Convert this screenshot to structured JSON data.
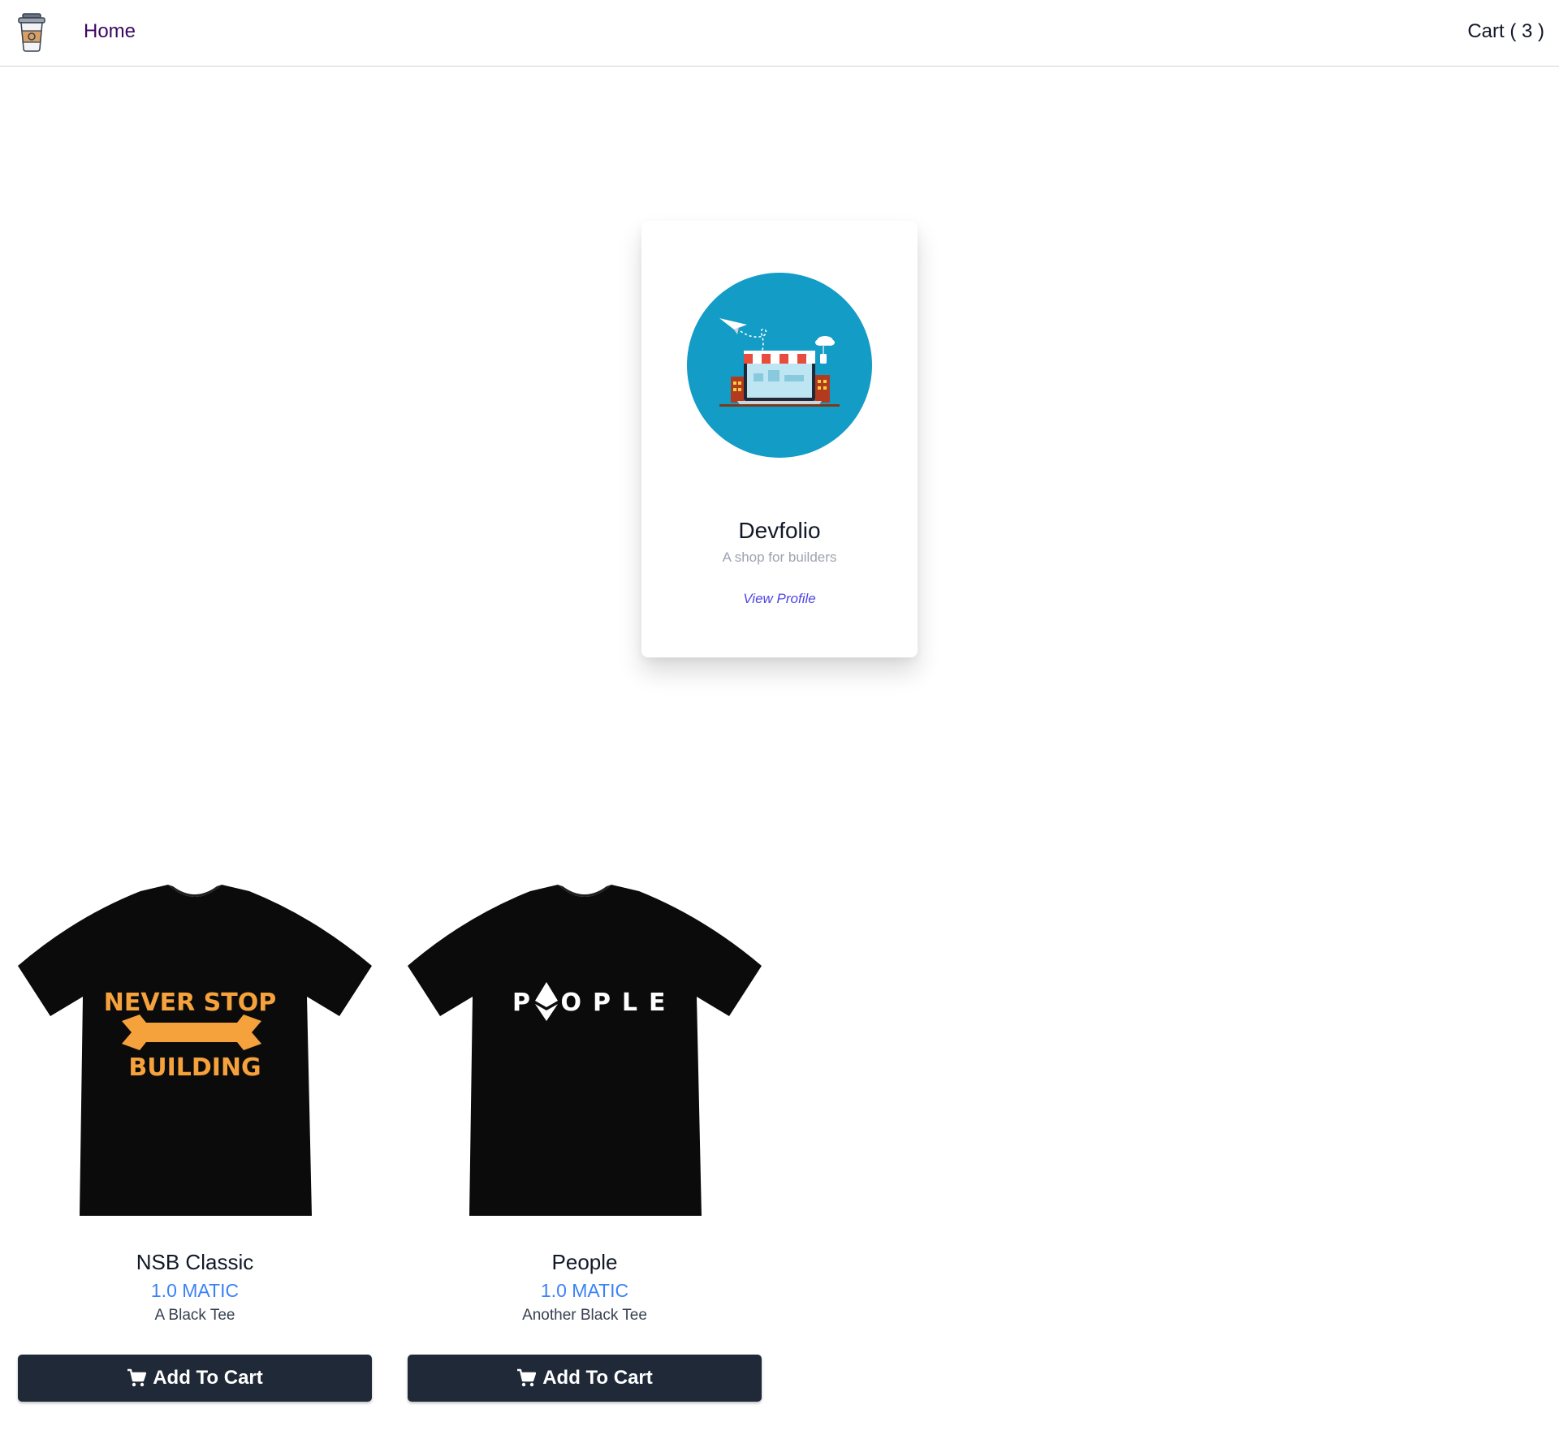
{
  "navbar": {
    "logo_icon": "coffee-cup-icon",
    "home_label": "Home",
    "cart_label": "Cart ( 3 )"
  },
  "profile": {
    "avatar_icon": "storefront-laptop-icon",
    "name": "Devfolio",
    "tagline": "A shop for builders",
    "view_profile_label": "View Profile"
  },
  "products": [
    {
      "name": "NSB Classic",
      "price": "1.0 MATIC",
      "description": "A Black Tee",
      "print_text_top": "NEVER STOP",
      "print_text_bottom": "BUILDING",
      "print_color": "#f6a23c",
      "button_label": "Add To Cart"
    },
    {
      "name": "People",
      "price": "1.0 MATIC",
      "description": "Another Black Tee",
      "print_text_left": "P",
      "print_text_right": "OPLE",
      "print_color": "#ffffff",
      "button_label": "Add To Cart"
    }
  ],
  "colors": {
    "accent_link": "#4f46e5",
    "price": "#3b82f6",
    "button_bg": "#1f2937",
    "avatar_bg": "#129cc6"
  }
}
